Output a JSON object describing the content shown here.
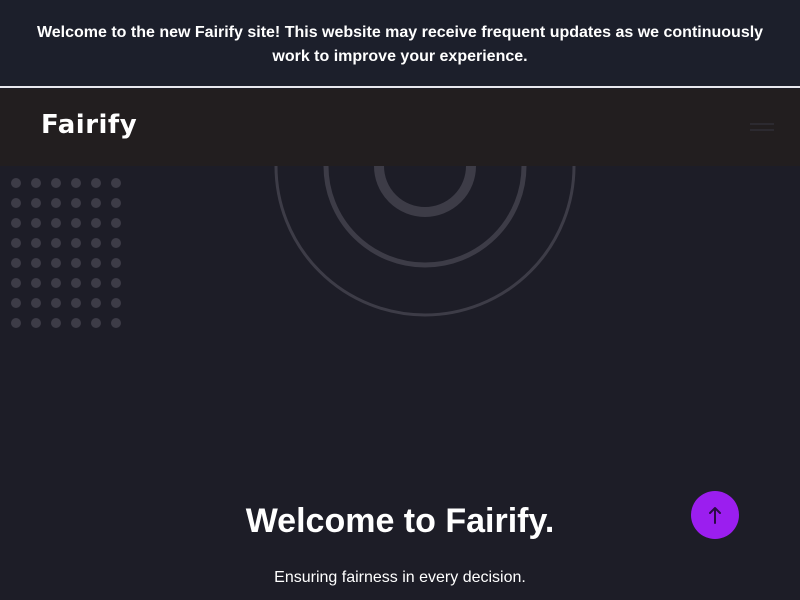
{
  "announcement": {
    "text": "Welcome to the new Fairify site! This website may receive frequent updates as we continuously work to improve your experience."
  },
  "navbar": {
    "logo_text": "Fairify",
    "menu_icon": "hamburger-menu-icon"
  },
  "hero": {
    "title": "Welcome to Fairify.",
    "subtitle": "Ensuring fairness in every decision."
  },
  "scroll_top": {
    "icon": "arrow-up-icon"
  },
  "colors": {
    "background": "#1d1d27",
    "announcement_bg": "#1c1f2b",
    "navbar_bg": "#221e1f",
    "accent": "#9b1eef",
    "decor": "#3d3c47"
  }
}
